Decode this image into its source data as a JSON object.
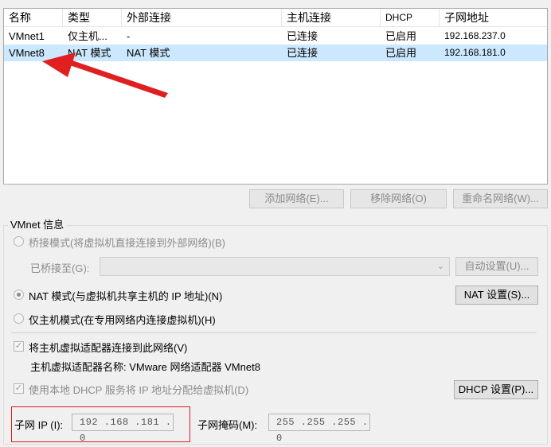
{
  "table": {
    "columns": [
      "名称",
      "类型",
      "外部连接",
      "主机连接",
      "DHCP",
      "子网地址"
    ],
    "rows": [
      {
        "name": "VMnet1",
        "type": "仅主机...",
        "external": "-",
        "host": "已连接",
        "dhcp": "已启用",
        "subnet": "192.168.237.0"
      },
      {
        "name": "VMnet8",
        "type": "NAT 模式",
        "external": "NAT 模式",
        "host": "已连接",
        "dhcp": "已启用",
        "subnet": "192.168.181.0"
      }
    ],
    "selected_row": 1
  },
  "buttons": {
    "add_network": "添加网络(E)...",
    "remove_network": "移除网络(O)",
    "rename_network": "重命名网络(W)..."
  },
  "vmnet_info": {
    "title": "VMnet 信息",
    "bridged_mode": "桥接模式(将虚拟机直接连接到外部网络)(B)",
    "bridged_to_label": "已桥接至(G):",
    "bridged_to_value": "",
    "auto_settings": "自动设置(U)...",
    "nat_mode": "NAT 模式(与虚拟机共享主机的 IP 地址)(N)",
    "nat_settings": "NAT 设置(S)...",
    "host_only_mode": "仅主机模式(在专用网络内连接虚拟机)(H)",
    "selected_mode": "nat",
    "connect_adapter": "将主机虚拟适配器连接到此网络(V)",
    "connect_adapter_checked": true,
    "adapter_name_label": "主机虚拟适配器名称: VMware 网络适配器 VMnet8",
    "use_dhcp": "使用本地 DHCP 服务将 IP 地址分配给虚拟机(D)",
    "use_dhcp_checked": true,
    "dhcp_settings": "DHCP 设置(P)...",
    "subnet_ip_label": "子网 IP (I):",
    "subnet_ip_value": "192 .168 .181 . 0",
    "subnet_mask_label": "子网掩码(M):",
    "subnet_mask_value": "255 .255 .255 . 0"
  },
  "colors": {
    "selection": "#cce8ff",
    "annotation_red": "#e02020"
  }
}
